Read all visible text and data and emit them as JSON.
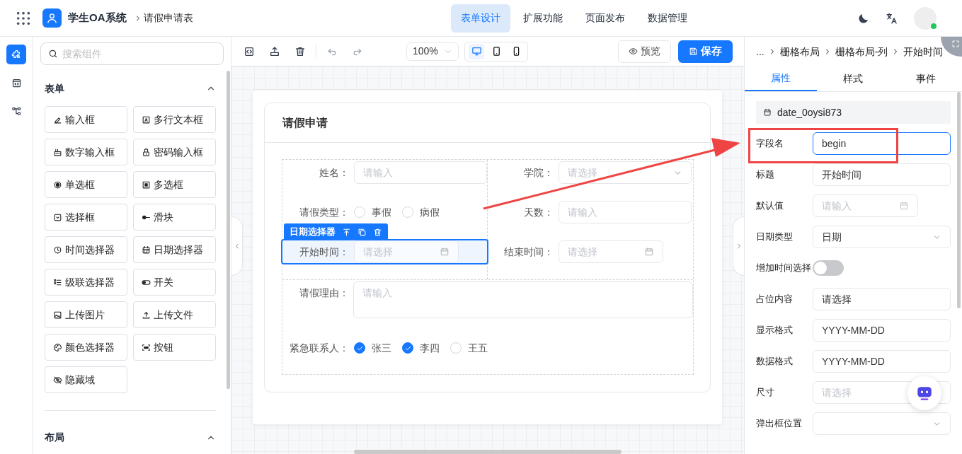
{
  "header": {
    "app_name": "学生OA系统",
    "page": "请假申请表",
    "nav": [
      {
        "label": "表单设计",
        "selected": true
      },
      {
        "label": "扩展功能",
        "selected": false
      },
      {
        "label": "页面发布",
        "selected": false
      },
      {
        "label": "数据管理",
        "selected": false
      }
    ]
  },
  "rail": [
    {
      "kind": "components",
      "selected": true
    },
    {
      "kind": "code",
      "selected": false
    },
    {
      "kind": "tree",
      "selected": false
    }
  ],
  "components": {
    "search_placeholder": "搜索组件",
    "groups": [
      {
        "title": "表单",
        "expanded": true,
        "items": [
          {
            "label": "输入框",
            "kind": "pen"
          },
          {
            "label": "多行文本框",
            "kind": "textbox"
          },
          {
            "label": "数字输入框",
            "kind": "number"
          },
          {
            "label": "密码输入框",
            "kind": "lock"
          },
          {
            "label": "单选框",
            "kind": "radio"
          },
          {
            "label": "多选框",
            "kind": "checkbox"
          },
          {
            "label": "选择框",
            "kind": "select"
          },
          {
            "label": "滑块",
            "kind": "slider"
          },
          {
            "label": "时间选择器",
            "kind": "clock"
          },
          {
            "label": "日期选择器",
            "kind": "calendar"
          },
          {
            "label": "级联选择器",
            "kind": "cascade"
          },
          {
            "label": "开关",
            "kind": "switch"
          },
          {
            "label": "上传图片",
            "kind": "image"
          },
          {
            "label": "上传文件",
            "kind": "upload"
          },
          {
            "label": "颜色选择器",
            "kind": "palette"
          },
          {
            "label": "按钮",
            "kind": "button"
          },
          {
            "label": "隐藏域",
            "kind": "hidden"
          }
        ]
      },
      {
        "title": "布局",
        "expanded": true
      }
    ]
  },
  "toolbar": {
    "zoom": "100%",
    "devices": [
      {
        "kind": "desktop",
        "selected": true
      },
      {
        "kind": "tablet",
        "selected": false
      },
      {
        "kind": "phone",
        "selected": false
      }
    ],
    "preview": "预览",
    "save": "保存"
  },
  "form": {
    "title": "请假申请",
    "tool_label": "日期选择器",
    "left": [
      {
        "kind": "input",
        "label": "姓名：",
        "placeholder": "请输入",
        "selected": false
      },
      {
        "kind": "radio",
        "label": "请假类型：",
        "selected": false,
        "options": [
          {
            "label": "事假",
            "selected": false
          },
          {
            "label": "病假",
            "selected": false
          }
        ]
      },
      {
        "kind": "date",
        "label": "开始时间：",
        "placeholder": "请选择",
        "selected": true
      }
    ],
    "right": [
      {
        "kind": "select",
        "label": "学院：",
        "placeholder": "请选择",
        "selected": false
      },
      {
        "kind": "input",
        "label": "天数：",
        "placeholder": "请输入",
        "selected": false
      },
      {
        "kind": "date",
        "label": "结束时间：",
        "placeholder": "请选择",
        "selected": false
      }
    ],
    "full": [
      {
        "kind": "textarea",
        "label": "请假理由：",
        "placeholder": "请输入",
        "selected": false
      },
      {
        "kind": "checkbox",
        "label": "紧急联系人：",
        "selected": false,
        "options": [
          {
            "label": "张三",
            "checked": true
          },
          {
            "label": "李四",
            "checked": true
          },
          {
            "label": "王五",
            "checked": false
          }
        ]
      }
    ]
  },
  "props": {
    "breadcrumb": [
      "...",
      "栅格布局",
      "栅格布局-列",
      "开始时间"
    ],
    "tabs": [
      {
        "label": "属性",
        "selected": true
      },
      {
        "label": "样式",
        "selected": false
      },
      {
        "label": "事件",
        "selected": false
      }
    ],
    "field_id": "date_0oysi873",
    "rows": [
      {
        "kind": "input",
        "label": "字段名",
        "value": "begin",
        "focused": true
      },
      {
        "kind": "input",
        "label": "标题",
        "value": "开始时间",
        "focused": false
      },
      {
        "kind": "date",
        "label": "默认值",
        "placeholder": "请输入"
      },
      {
        "kind": "select",
        "label": "日期类型",
        "value": "日期"
      },
      {
        "kind": "switch",
        "label": "增加时间选择",
        "on": false
      },
      {
        "kind": "input",
        "label": "占位内容",
        "value": "请选择",
        "focused": false
      },
      {
        "kind": "input",
        "label": "显示格式",
        "value": "YYYY-MM-DD",
        "focused": false
      },
      {
        "kind": "input",
        "label": "数据格式",
        "value": "YYYY-MM-DD",
        "focused": false
      },
      {
        "kind": "select",
        "label": "尺寸",
        "placeholder": "请选择"
      },
      {
        "kind": "select",
        "label": "弹出框位置"
      }
    ]
  }
}
